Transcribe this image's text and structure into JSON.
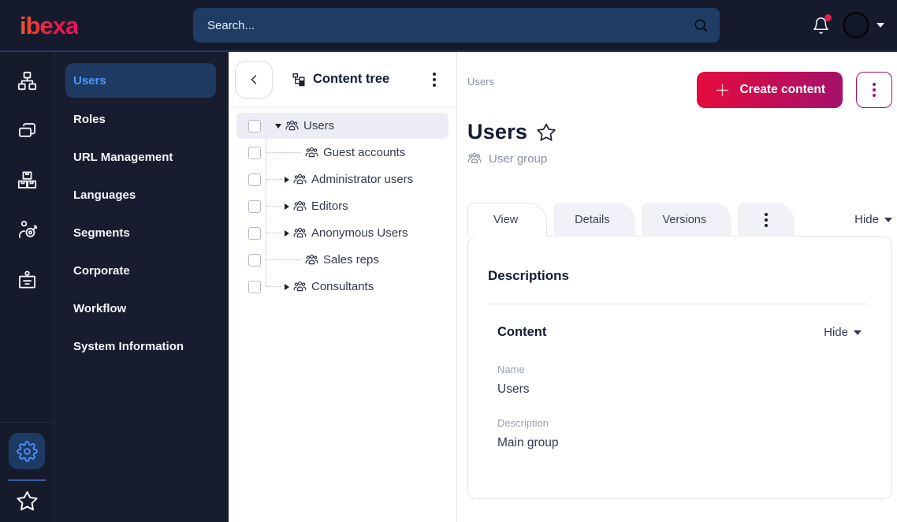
{
  "topbar": {
    "logo_text": "ibexa",
    "search_placeholder": "Search...",
    "notifications": {
      "unread_badge": true
    }
  },
  "iconbar": {
    "top_icons": [
      "sitemap-icon",
      "pages-icon",
      "product-boxes-icon",
      "personalization-target-icon",
      "id-badge-icon"
    ],
    "bottom_icons": [
      "gear-icon",
      "star-icon"
    ],
    "active_icon": "gear-icon"
  },
  "menu": {
    "items": [
      {
        "label": "Users",
        "active": true
      },
      {
        "label": "Roles",
        "active": false
      },
      {
        "label": "URL Management",
        "active": false
      },
      {
        "label": "Languages",
        "active": false
      },
      {
        "label": "Segments",
        "active": false
      },
      {
        "label": "Corporate",
        "active": false
      },
      {
        "label": "Workflow",
        "active": false
      },
      {
        "label": "System Information",
        "active": false
      }
    ]
  },
  "content_tree": {
    "title": "Content tree",
    "items": [
      {
        "label": "Users",
        "level": 0,
        "state": "expanded",
        "selected": true,
        "checked": false,
        "icon": "user-group-icon"
      },
      {
        "label": "Guest accounts",
        "level": 1,
        "state": "leaf",
        "selected": false,
        "checked": false,
        "icon": "user-group-icon"
      },
      {
        "label": "Administrator users",
        "level": 1,
        "state": "collapsed",
        "selected": false,
        "checked": false,
        "icon": "user-group-icon"
      },
      {
        "label": "Editors",
        "level": 1,
        "state": "collapsed",
        "selected": false,
        "checked": false,
        "icon": "user-group-icon"
      },
      {
        "label": "Anonymous Users",
        "level": 1,
        "state": "collapsed",
        "selected": false,
        "checked": false,
        "icon": "user-group-icon"
      },
      {
        "label": "Sales reps",
        "level": 1,
        "state": "leaf",
        "selected": false,
        "checked": false,
        "icon": "user-group-icon"
      },
      {
        "label": "Consultants",
        "level": 1,
        "state": "collapsed",
        "selected": false,
        "checked": false,
        "icon": "user-group-icon"
      }
    ]
  },
  "main": {
    "breadcrumb": "Users",
    "create_button_label": "Create content",
    "title": "Users",
    "content_type": "User group",
    "tabs": [
      {
        "label": "View",
        "active": true
      },
      {
        "label": "Details",
        "active": false
      },
      {
        "label": "Versions",
        "active": false
      }
    ],
    "hide_toggle_label": "Hide",
    "card": {
      "heading": "Descriptions",
      "section": {
        "heading": "Content",
        "hide_toggle_label": "Hide",
        "fields": [
          {
            "label": "Name",
            "value": "Users"
          },
          {
            "label": "Description",
            "value": "Main group"
          }
        ]
      }
    }
  },
  "colors": {
    "topbar_bg": "#151a2c",
    "sidebar_bg": "#161b2c",
    "search_bg": "#1e3c64",
    "selected_menu_bg": "#1e3a63",
    "accent_blue": "#4d96ff",
    "primary_gradient_start": "#e50b3d",
    "primary_gradient_end": "#a4116b",
    "tree_selected_row_bg": "#ececf4",
    "notification_badge": "#e0244c",
    "heading_text": "#131c33"
  }
}
